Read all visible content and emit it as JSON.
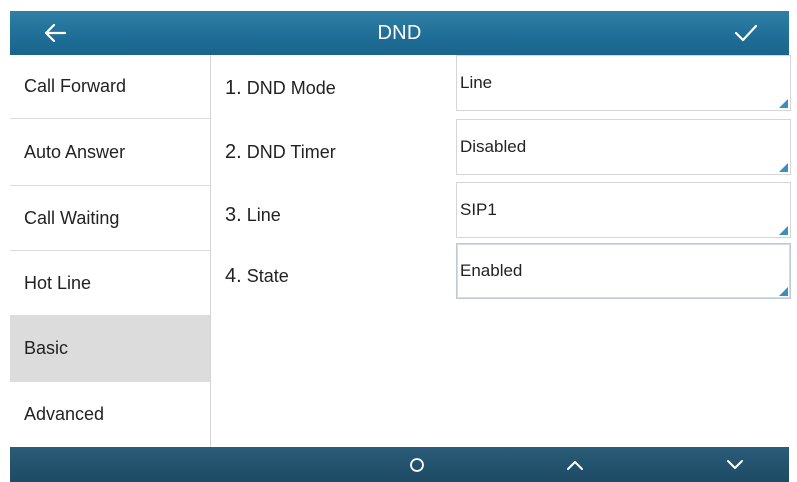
{
  "header": {
    "title": "DND",
    "back_icon": "arrow-left-icon",
    "confirm_icon": "check-icon"
  },
  "sidebar": {
    "items": [
      {
        "label": "Call Forward"
      },
      {
        "label": "Auto Answer"
      },
      {
        "label": "Call Waiting"
      },
      {
        "label": "Hot Line"
      },
      {
        "label": "Basic",
        "active": true
      },
      {
        "label": "Advanced"
      }
    ]
  },
  "settings": [
    {
      "num": "1.",
      "label": "DND Mode",
      "value": "Line"
    },
    {
      "num": "2.",
      "label": "DND Timer",
      "value": "Disabled"
    },
    {
      "num": "3.",
      "label": "Line",
      "value": "SIP1"
    },
    {
      "num": "4.",
      "label": "State",
      "value": "Enabled",
      "focused": true
    }
  ],
  "footer": {
    "buttons": [
      "circle-icon",
      "chevron-up-icon",
      "chevron-down-icon"
    ]
  },
  "colors": {
    "header": "#1f6f98",
    "footer": "#23506b",
    "active_item": "#dcdcdc",
    "corner_marker": "#3a8fc0"
  }
}
